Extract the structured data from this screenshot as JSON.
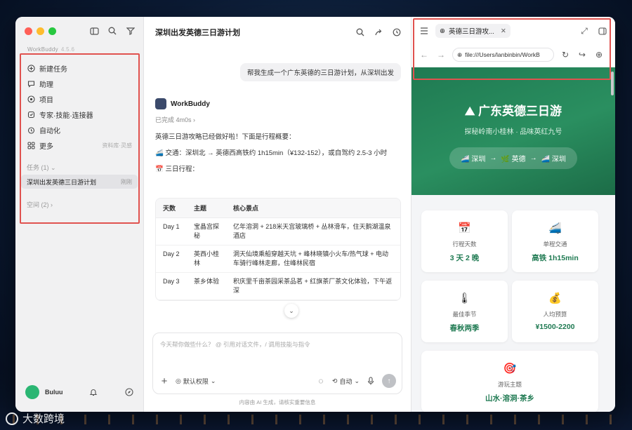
{
  "sidebar": {
    "brand": "WorkBuddy",
    "version": "4.5.6",
    "items": [
      {
        "label": "新建任务",
        "icon": "plus-circle-icon"
      },
      {
        "label": "助理",
        "icon": "chat-bubble-icon"
      },
      {
        "label": "项目",
        "icon": "project-icon"
      },
      {
        "label": "专家·技能·连接器",
        "icon": "expert-icon"
      },
      {
        "label": "自动化",
        "icon": "alarm-clock-icon"
      },
      {
        "label": "更多",
        "icon": "grid-icon",
        "hint": "资料库·灵感"
      }
    ],
    "tasks_section": "任务 (1)",
    "task": {
      "title": "深圳出发英德三日游计划",
      "when": "刚刚"
    },
    "space_section": "空间 (2)",
    "user": "Buluu"
  },
  "chat": {
    "title": "深圳出发英德三日游计划",
    "user_message": "帮我生成一个广东英德的三日游计划，从深圳出发",
    "bot_name": "WorkBuddy",
    "status": "已完成 4m0s",
    "intro": "英德三日游攻略已经做好啦！下面是行程概要：",
    "transport": "🚄 交通：深圳北 → 英德西高铁约 1h15min（¥132-152），或自驾约 2.5-3 小时",
    "itinerary_label": "📅 三日行程：",
    "table": {
      "headers": [
        "天数",
        "主题",
        "核心景点"
      ],
      "rows": [
        [
          "Day 1",
          "宝晶宫探秘",
          "亿年溶洞 + 218米天宫玻璃桥 + 丛林滑车，住天鹅湖温泉酒店"
        ],
        [
          "Day 2",
          "英西小桂林",
          "洞天仙境乘船穿越天坑 + 峰林晓镇小火车/热气球 + 电动车骑行峰林走廊，住峰林民宿"
        ],
        [
          "Day 3",
          "茶乡体验",
          "积庆里千亩茶园采茶品茗 + 红旗茶厂茶文化体验，下午返深"
        ]
      ]
    },
    "composer_placeholder": "今天帮你做些什么？ @ 引用对话文件，/ 调用技能与指令",
    "permission": "默认权限",
    "mode": "自动",
    "footer": "内容由 AI 生成，请核实重要信息"
  },
  "browser": {
    "tab_title": "英德三日游攻...",
    "url": "file:///Users/lanbinbin/WorkB",
    "hero_title": "⛰ 广东英德三日游",
    "hero_subtitle": "探秘岭南小桂林 · 品味英红九号",
    "route": [
      "🚄 深圳",
      "→",
      "🌿 英德",
      "→",
      "🚄 深圳"
    ],
    "cards": [
      {
        "emoji": "📅",
        "label": "行程天数",
        "value": "3 天 2 晚"
      },
      {
        "emoji": "🚄",
        "label": "单程交通",
        "value": "高铁 1h15min"
      },
      {
        "emoji": "🌡",
        "label": "最佳季节",
        "value": "春秋两季"
      },
      {
        "emoji": "💰",
        "label": "人均预算",
        "value": "¥1500-2200"
      },
      {
        "emoji": "🎯",
        "label": "游玩主题",
        "value": "山水·溶洞·茶乡"
      }
    ]
  },
  "watermark": "大数跨境",
  "colors": {
    "accent": "#1f7a52",
    "highlight_box": "#e0524f"
  }
}
